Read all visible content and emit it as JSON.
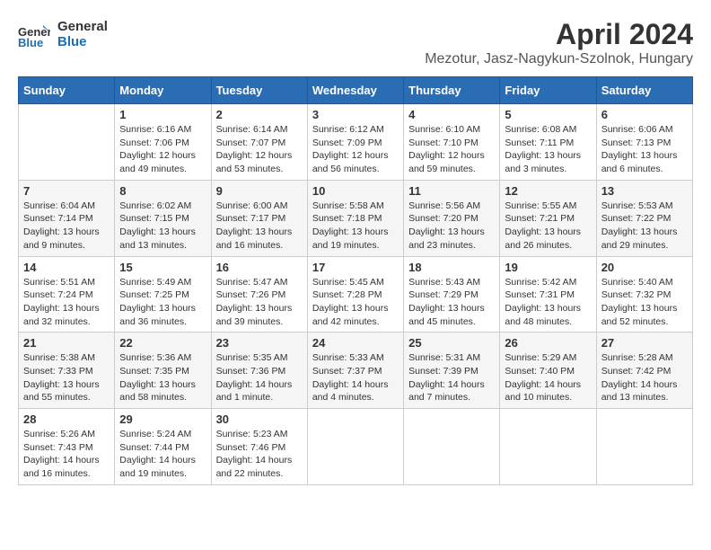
{
  "logo": {
    "line1": "General",
    "line2": "Blue"
  },
  "title": "April 2024",
  "subtitle": "Mezotur, Jasz-Nagykun-Szolnok, Hungary",
  "days_of_week": [
    "Sunday",
    "Monday",
    "Tuesday",
    "Wednesday",
    "Thursday",
    "Friday",
    "Saturday"
  ],
  "weeks": [
    [
      {
        "day": "",
        "info": ""
      },
      {
        "day": "1",
        "info": "Sunrise: 6:16 AM\nSunset: 7:06 PM\nDaylight: 12 hours\nand 49 minutes."
      },
      {
        "day": "2",
        "info": "Sunrise: 6:14 AM\nSunset: 7:07 PM\nDaylight: 12 hours\nand 53 minutes."
      },
      {
        "day": "3",
        "info": "Sunrise: 6:12 AM\nSunset: 7:09 PM\nDaylight: 12 hours\nand 56 minutes."
      },
      {
        "day": "4",
        "info": "Sunrise: 6:10 AM\nSunset: 7:10 PM\nDaylight: 12 hours\nand 59 minutes."
      },
      {
        "day": "5",
        "info": "Sunrise: 6:08 AM\nSunset: 7:11 PM\nDaylight: 13 hours\nand 3 minutes."
      },
      {
        "day": "6",
        "info": "Sunrise: 6:06 AM\nSunset: 7:13 PM\nDaylight: 13 hours\nand 6 minutes."
      }
    ],
    [
      {
        "day": "7",
        "info": "Sunrise: 6:04 AM\nSunset: 7:14 PM\nDaylight: 13 hours\nand 9 minutes."
      },
      {
        "day": "8",
        "info": "Sunrise: 6:02 AM\nSunset: 7:15 PM\nDaylight: 13 hours\nand 13 minutes."
      },
      {
        "day": "9",
        "info": "Sunrise: 6:00 AM\nSunset: 7:17 PM\nDaylight: 13 hours\nand 16 minutes."
      },
      {
        "day": "10",
        "info": "Sunrise: 5:58 AM\nSunset: 7:18 PM\nDaylight: 13 hours\nand 19 minutes."
      },
      {
        "day": "11",
        "info": "Sunrise: 5:56 AM\nSunset: 7:20 PM\nDaylight: 13 hours\nand 23 minutes."
      },
      {
        "day": "12",
        "info": "Sunrise: 5:55 AM\nSunset: 7:21 PM\nDaylight: 13 hours\nand 26 minutes."
      },
      {
        "day": "13",
        "info": "Sunrise: 5:53 AM\nSunset: 7:22 PM\nDaylight: 13 hours\nand 29 minutes."
      }
    ],
    [
      {
        "day": "14",
        "info": "Sunrise: 5:51 AM\nSunset: 7:24 PM\nDaylight: 13 hours\nand 32 minutes."
      },
      {
        "day": "15",
        "info": "Sunrise: 5:49 AM\nSunset: 7:25 PM\nDaylight: 13 hours\nand 36 minutes."
      },
      {
        "day": "16",
        "info": "Sunrise: 5:47 AM\nSunset: 7:26 PM\nDaylight: 13 hours\nand 39 minutes."
      },
      {
        "day": "17",
        "info": "Sunrise: 5:45 AM\nSunset: 7:28 PM\nDaylight: 13 hours\nand 42 minutes."
      },
      {
        "day": "18",
        "info": "Sunrise: 5:43 AM\nSunset: 7:29 PM\nDaylight: 13 hours\nand 45 minutes."
      },
      {
        "day": "19",
        "info": "Sunrise: 5:42 AM\nSunset: 7:31 PM\nDaylight: 13 hours\nand 48 minutes."
      },
      {
        "day": "20",
        "info": "Sunrise: 5:40 AM\nSunset: 7:32 PM\nDaylight: 13 hours\nand 52 minutes."
      }
    ],
    [
      {
        "day": "21",
        "info": "Sunrise: 5:38 AM\nSunset: 7:33 PM\nDaylight: 13 hours\nand 55 minutes."
      },
      {
        "day": "22",
        "info": "Sunrise: 5:36 AM\nSunset: 7:35 PM\nDaylight: 13 hours\nand 58 minutes."
      },
      {
        "day": "23",
        "info": "Sunrise: 5:35 AM\nSunset: 7:36 PM\nDaylight: 14 hours\nand 1 minute."
      },
      {
        "day": "24",
        "info": "Sunrise: 5:33 AM\nSunset: 7:37 PM\nDaylight: 14 hours\nand 4 minutes."
      },
      {
        "day": "25",
        "info": "Sunrise: 5:31 AM\nSunset: 7:39 PM\nDaylight: 14 hours\nand 7 minutes."
      },
      {
        "day": "26",
        "info": "Sunrise: 5:29 AM\nSunset: 7:40 PM\nDaylight: 14 hours\nand 10 minutes."
      },
      {
        "day": "27",
        "info": "Sunrise: 5:28 AM\nSunset: 7:42 PM\nDaylight: 14 hours\nand 13 minutes."
      }
    ],
    [
      {
        "day": "28",
        "info": "Sunrise: 5:26 AM\nSunset: 7:43 PM\nDaylight: 14 hours\nand 16 minutes."
      },
      {
        "day": "29",
        "info": "Sunrise: 5:24 AM\nSunset: 7:44 PM\nDaylight: 14 hours\nand 19 minutes."
      },
      {
        "day": "30",
        "info": "Sunrise: 5:23 AM\nSunset: 7:46 PM\nDaylight: 14 hours\nand 22 minutes."
      },
      {
        "day": "",
        "info": ""
      },
      {
        "day": "",
        "info": ""
      },
      {
        "day": "",
        "info": ""
      },
      {
        "day": "",
        "info": ""
      }
    ]
  ]
}
